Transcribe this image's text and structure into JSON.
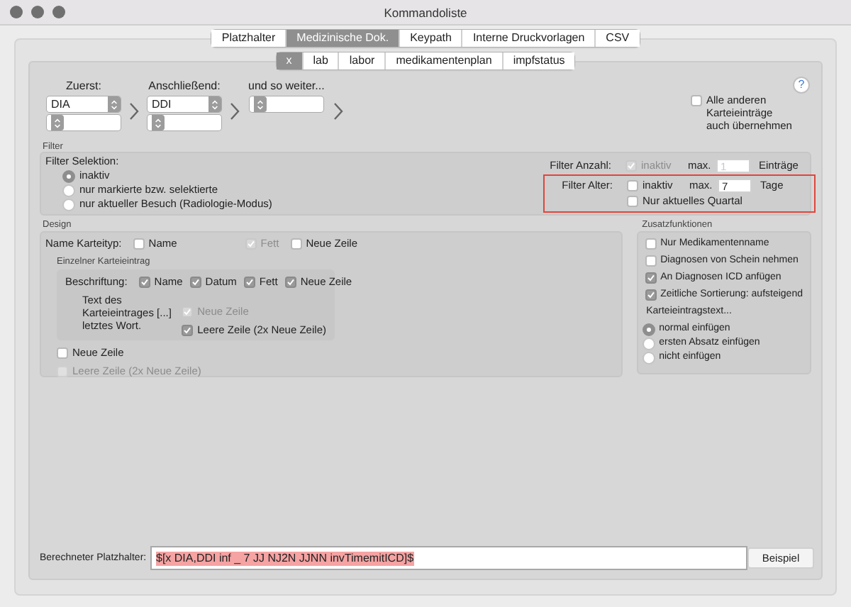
{
  "window": {
    "title": "Kommandoliste"
  },
  "tabs": [
    {
      "label": "Platzhalter",
      "selected": false
    },
    {
      "label": "Medizinische Dok.",
      "selected": true
    },
    {
      "label": "Keypath",
      "selected": false
    },
    {
      "label": "Interne Druckvorlagen",
      "selected": false
    },
    {
      "label": "CSV",
      "selected": false
    }
  ],
  "subtabs": [
    {
      "label": "x",
      "selected": true
    },
    {
      "label": "lab",
      "selected": false
    },
    {
      "label": "labor",
      "selected": false
    },
    {
      "label": "medikamentenplan",
      "selected": false
    },
    {
      "label": "impfstatus",
      "selected": false
    }
  ],
  "help": {
    "label": "?"
  },
  "chain": [
    {
      "label": "Zuerst:",
      "value": "DIA",
      "extra_popup": true
    },
    {
      "label": "Anschließend:",
      "value": "DDI",
      "extra_popup": true
    },
    {
      "label": "und so weiter...",
      "extra_popup": false
    }
  ],
  "alle_anderen": {
    "label": "Alle anderen Karteieinträge auch übernehmen",
    "checked": false
  },
  "filter": {
    "title": "Filter",
    "selektion": {
      "label": "Filter Selektion:",
      "options": [
        {
          "label": "inaktiv",
          "selected": true
        },
        {
          "label": "nur markierte bzw. selektierte",
          "selected": false
        },
        {
          "label": "nur aktueller Besuch (Radiologie-Modus)",
          "selected": false
        }
      ]
    },
    "anzahl": {
      "label": "Filter Anzahl:",
      "checkbox": {
        "label": "inaktiv",
        "checked": true,
        "disabled": true
      },
      "max_label": "max.",
      "value": "1",
      "value_disabled": true,
      "unit": "Einträge"
    },
    "alter": {
      "label": "Filter Alter:",
      "highlighted": true,
      "checkbox": {
        "label": "inaktiv",
        "checked": false,
        "disabled": false
      },
      "max_label": "max.",
      "value": "7",
      "value_disabled": false,
      "unit": "Tage",
      "quartal": {
        "label": "Nur aktuelles Quartal",
        "checked": false,
        "disabled": false
      }
    }
  },
  "design": {
    "title": "Design",
    "name_karteityp": {
      "label": "Name Karteityp:",
      "options": [
        {
          "label": "Name",
          "checked": false,
          "disabled": false
        },
        {
          "label": "Fett",
          "checked": true,
          "disabled": true
        },
        {
          "label": "Neue Zeile",
          "checked": false,
          "disabled": false
        }
      ]
    },
    "einzelner": {
      "title": "Einzelner Karteieintrag",
      "beschriftung": {
        "label": "Beschriftung:",
        "options": [
          {
            "label": "Name",
            "checked": true,
            "disabled": false
          },
          {
            "label": "Datum",
            "checked": true,
            "disabled": false
          },
          {
            "label": "Fett",
            "checked": true,
            "disabled": false
          },
          {
            "label": "Neue Zeile",
            "checked": true,
            "disabled": false
          }
        ]
      },
      "text_label": "Text des Karteieintrages [...] letztes Wort.",
      "text_options": [
        {
          "label": "Neue Zeile",
          "checked": true,
          "disabled": true
        },
        {
          "label": "Leere Zeile (2x Neue Zeile)",
          "checked": true,
          "disabled": false
        }
      ]
    },
    "after": [
      {
        "label": "Neue Zeile",
        "checked": false,
        "disabled": false
      },
      {
        "label": "Leere Zeile (2x Neue Zeile)",
        "checked": false,
        "disabled": true
      }
    ]
  },
  "zusatz": {
    "title": "Zusatzfunktionen",
    "checks": [
      {
        "label": "Nur Medikamentenname",
        "checked": false,
        "disabled": false
      },
      {
        "label": "Diagnosen von Schein nehmen",
        "checked": false,
        "disabled": false
      },
      {
        "label": "An Diagnosen ICD anfügen",
        "checked": true,
        "disabled": false
      },
      {
        "label": "Zeitliche Sortierung: aufsteigend",
        "checked": true,
        "disabled": false
      }
    ],
    "text_label": "Karteieintragstext...",
    "options": [
      {
        "label": "normal einfügen",
        "selected": true
      },
      {
        "label": "ersten Absatz einfügen",
        "selected": false
      },
      {
        "label": "nicht einfügen",
        "selected": false
      }
    ]
  },
  "result": {
    "label": "Berechneter Platzhalter:",
    "value": "$[x DIA,DDI inf _ 7 JJ NJ2N JJNN invTimemitICD]$",
    "text_selected": true,
    "button": "Beispiel"
  }
}
